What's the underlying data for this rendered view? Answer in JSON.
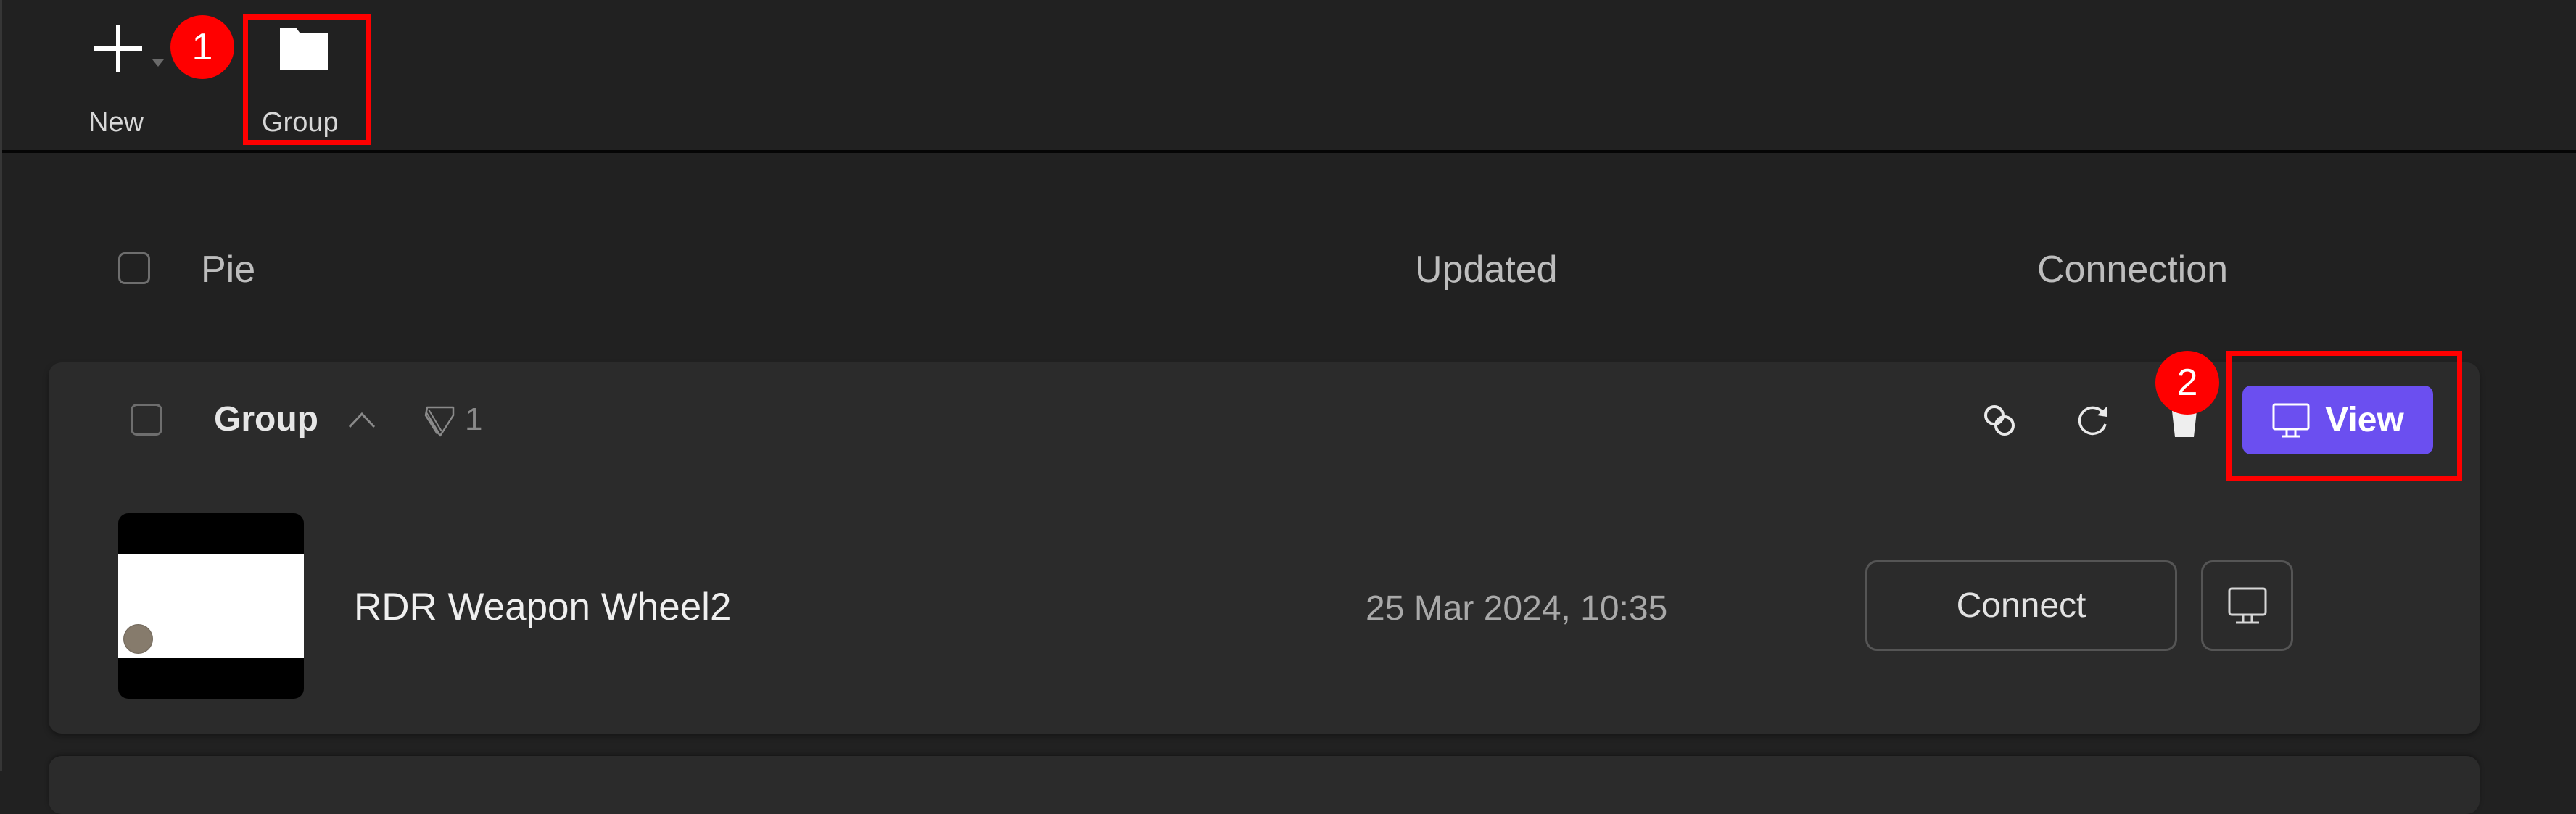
{
  "toolbar": {
    "new_label": "New",
    "group_label": "Group",
    "icons": {
      "new": "plus-icon",
      "new_dropdown": "caret-down-icon",
      "group": "folder-icon"
    }
  },
  "annotations": [
    {
      "number": "1",
      "color": "#ff0000",
      "target": "toolbar-group-button"
    },
    {
      "number": "2",
      "color": "#ff0000",
      "target": "view-button"
    }
  ],
  "table": {
    "columns": {
      "name": "Pie",
      "updated": "Updated",
      "connection": "Connection"
    }
  },
  "groups": [
    {
      "name": "Group",
      "expanded": true,
      "pie_count": "1",
      "actions": {
        "link_icon": "link-icon",
        "refresh_icon": "refresh-icon",
        "delete_icon": "trash-icon",
        "view_label": "View",
        "view_icon": "monitor-icon"
      },
      "items": [
        {
          "title": "RDR Weapon Wheel2",
          "updated": "25 Mar 2024, 10:35",
          "connect_label": "Connect",
          "monitor_icon": "monitor-icon"
        }
      ]
    }
  ],
  "colors": {
    "accent": "#6b4ff0",
    "background": "#212121",
    "card": "#2b2b2b",
    "annotation": "#ff0000"
  }
}
